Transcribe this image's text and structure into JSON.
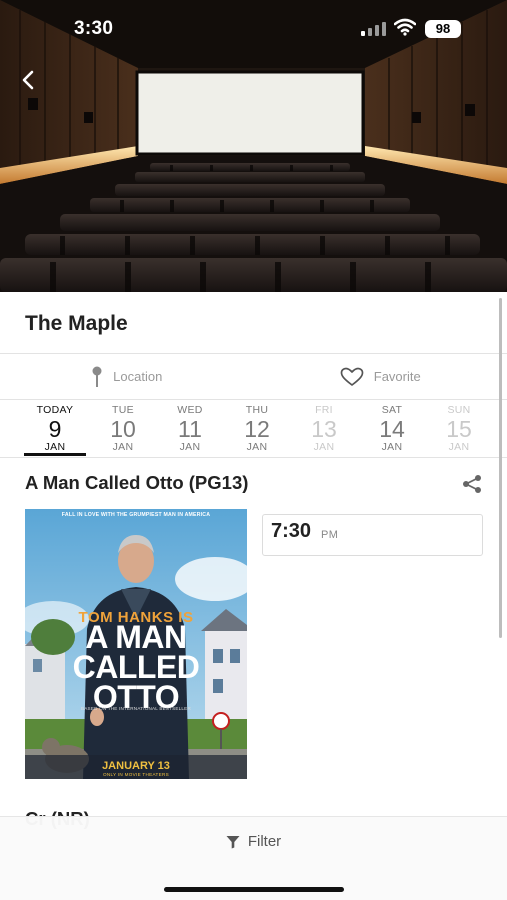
{
  "status_bar": {
    "time": "3:30",
    "battery": "98"
  },
  "theater": {
    "name": "The Maple"
  },
  "actions": {
    "location_label": "Location",
    "favorite_label": "Favorite"
  },
  "dates": [
    {
      "dow": "TODAY",
      "day": "9",
      "mon": "JAN",
      "state": "active"
    },
    {
      "dow": "TUE",
      "day": "10",
      "mon": "JAN",
      "state": "normal"
    },
    {
      "dow": "WED",
      "day": "11",
      "mon": "JAN",
      "state": "normal"
    },
    {
      "dow": "THU",
      "day": "12",
      "mon": "JAN",
      "state": "normal"
    },
    {
      "dow": "FRI",
      "day": "13",
      "mon": "JAN",
      "state": "faded"
    },
    {
      "dow": "SAT",
      "day": "14",
      "mon": "JAN",
      "state": "normal"
    },
    {
      "dow": "SUN",
      "day": "15",
      "mon": "JAN",
      "state": "faded"
    }
  ],
  "movie": {
    "title": "A Man Called Otto (PG13)",
    "poster": {
      "tagline": "FALL IN LOVE WITH THE GRUMPIEST MAN IN AMERICA",
      "actor": "TOM HANKS IS",
      "title": "A MAN\nCALLED\nOTTO",
      "based_on": "BASED ON THE INTERNATIONAL BESTSELLER",
      "release": "JANUARY 13",
      "release_note": "ONLY IN MOVIE THEATERS"
    },
    "showtimes": [
      {
        "time": "7:30",
        "ampm": "PM"
      }
    ]
  },
  "next_movie": {
    "title": "Cr (NR)"
  },
  "filter": {
    "label": "Filter"
  },
  "icons": {
    "back": "chevron-left-icon",
    "location": "pin-icon",
    "favorite": "heart-icon",
    "share": "share-icon",
    "filter": "funnel-icon"
  }
}
